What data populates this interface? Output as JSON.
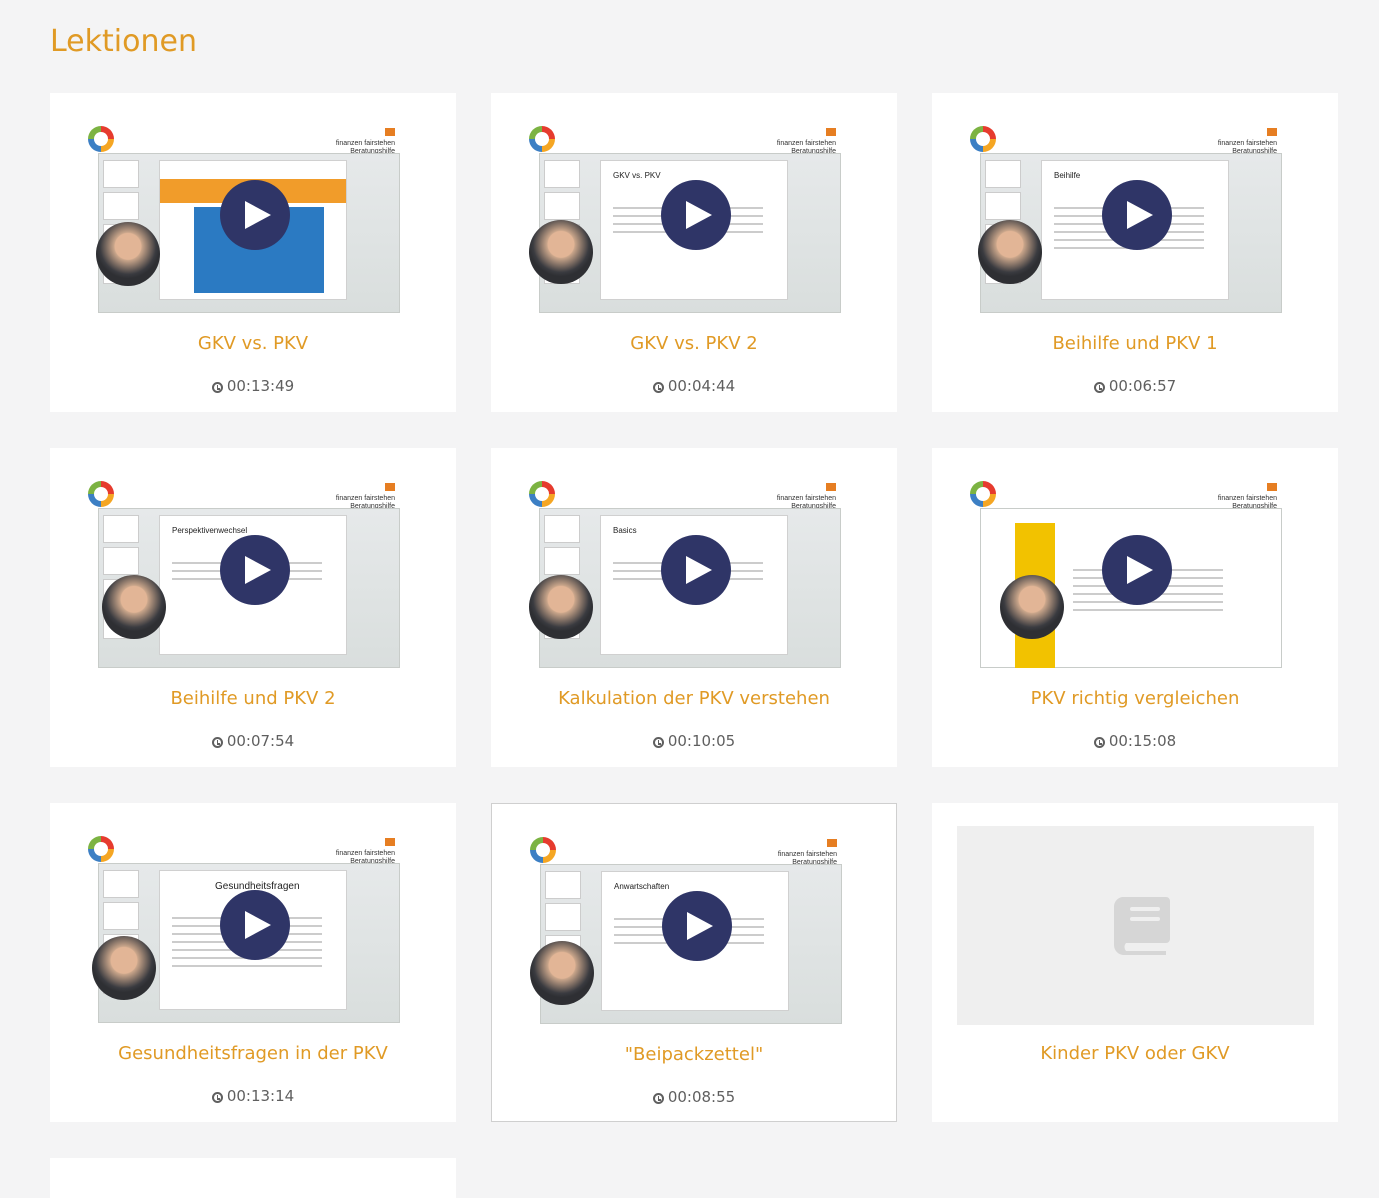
{
  "page": {
    "title": "Lektionen"
  },
  "lessons": [
    {
      "title": "GKV vs. PKV",
      "duration": "00:13:49",
      "slide_title": ""
    },
    {
      "title": "GKV vs. PKV 2",
      "duration": "00:04:44",
      "slide_title": "GKV vs. PKV"
    },
    {
      "title": "Beihilfe und PKV 1",
      "duration": "00:06:57",
      "slide_title": "Beihilfe"
    },
    {
      "title": "Beihilfe und PKV 2",
      "duration": "00:07:54",
      "slide_title": "Perspektivenwechsel"
    },
    {
      "title": "Kalkulation der PKV verstehen",
      "duration": "00:10:05",
      "slide_title": "Basics"
    },
    {
      "title": "PKV richtig vergleichen",
      "duration": "00:15:08",
      "slide_title": ""
    },
    {
      "title": "Gesundheitsfragen in der PKV",
      "duration": "00:13:14",
      "slide_title": "Gesundheitsfragen"
    },
    {
      "title": "\"Beipackzettel\"",
      "duration": "00:08:55",
      "slide_title": "Anwartschaften"
    },
    {
      "title": "Kinder PKV oder GKV",
      "duration": "",
      "slide_title": ""
    }
  ],
  "thumbnail_branding": {
    "left_logo": "versicherungsladen",
    "right_logo_line1": "finanzen fairstehen",
    "right_logo_line2": "Beratungshilfe"
  },
  "icons": {
    "play": "play-icon",
    "clock": "clock-icon",
    "book": "book-icon"
  },
  "colors": {
    "accent": "#e09a25",
    "play_button": "#2f3567",
    "background": "#f4f4f5",
    "card": "#ffffff"
  }
}
